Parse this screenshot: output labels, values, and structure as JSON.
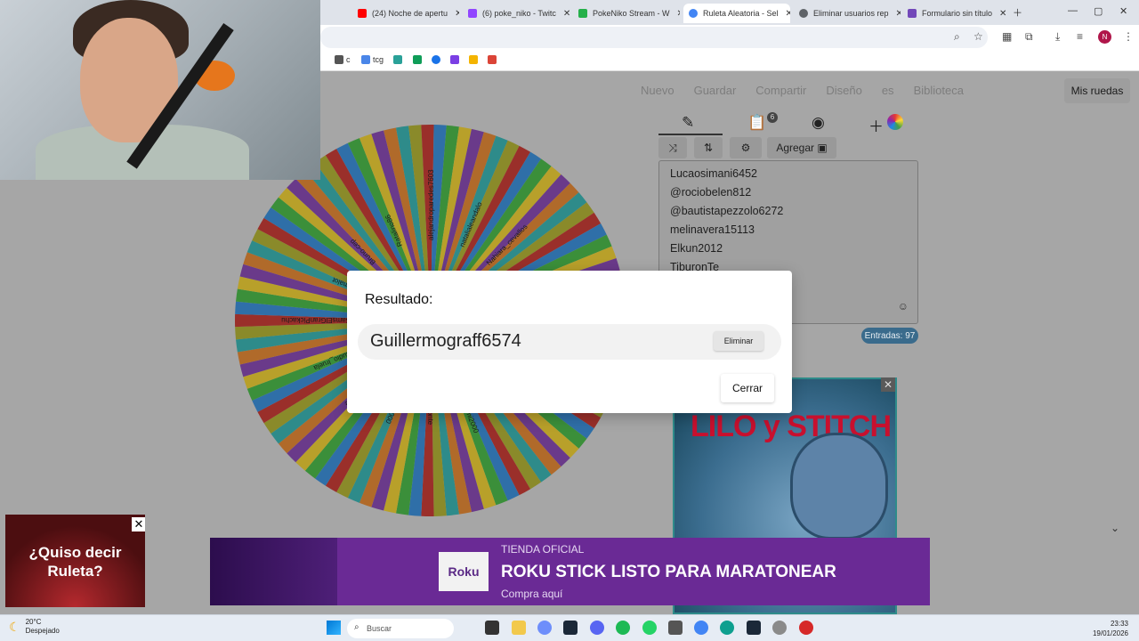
{
  "browser": {
    "tabs": [
      {
        "title": "(24) Noche de apertu",
        "color": "#ff0000"
      },
      {
        "title": "(6) poke_niko - Twitc",
        "color": "#9146ff"
      },
      {
        "title": "PokeNiko Stream - W",
        "color": "#25b04a"
      },
      {
        "title": "Ruleta Aleatoria - Sel",
        "color": "#4285f4"
      },
      {
        "title": "Eliminar usuarios rep",
        "color": "#5f6368"
      },
      {
        "title": "Formulario sin título",
        "color": "#7248b9"
      }
    ],
    "avatar_letter": "N",
    "bookmarks": [
      {
        "label": "c",
        "color": "#555555"
      },
      {
        "label": "tcg",
        "color": "#4a86e8"
      },
      {
        "label": "",
        "color": "#2aa198"
      },
      {
        "label": "",
        "color": "#0f9d58"
      },
      {
        "label": "",
        "color": "#1a73e8"
      },
      {
        "label": "",
        "color": "#7b3fe4"
      },
      {
        "label": "",
        "color": "#f4b400"
      },
      {
        "label": "",
        "color": "#db4437"
      }
    ]
  },
  "wheel_page": {
    "header": {
      "nuevo": "Nuevo",
      "guardar": "Guardar",
      "compartir": "Compartir",
      "diseno": "Diseño",
      "lang": "es",
      "biblioteca": "Biblioteca",
      "mis_ruedas": "Mis ruedas"
    },
    "editor_badge": "6",
    "agregar_label": "Agregar",
    "entries": [
      "Lucaosimani6452",
      "@rociobelen812",
      "@bautistapezzolo6272",
      "melinavera15113",
      "Elkun2012",
      "TiburonTe"
    ],
    "entries_count": "Entradas: 97",
    "wheel_labels": [
      "Guillermograff6574",
      "Mauriaoo_s",
      "ElBromasUp",
      "magami2000",
      "Eleonte",
      "chee6000",
      "Carlos_Lelle",
      "Claudio_Iruela",
      "SamsElGranPickachu",
      "Kamalot",
      "Bruno-cep",
      "Ratalino86",
      "alejandroparedes7603",
      "natalialeandalo",
      "Nahiara_cevallos",
      "maurjalieba"
    ],
    "ad_title": "LILO y STITCH"
  },
  "modal": {
    "title": "Resultado:",
    "result": "Guillermograff6574",
    "eliminar": "Eliminar",
    "cerrar": "Cerrar"
  },
  "promo": {
    "text": "¿Quiso decir Ruleta?"
  },
  "banner": {
    "kicker": "TIENDA OFICIAL",
    "headline": "ROKU STICK LISTO PARA MARATONEAR",
    "cta": "Compra aquí",
    "logo": "Roku"
  },
  "taskbar": {
    "temperature": "20°C",
    "weather": "Despejado",
    "search_placeholder": "Buscar",
    "time": "23:33",
    "date": "19/01/2026"
  }
}
